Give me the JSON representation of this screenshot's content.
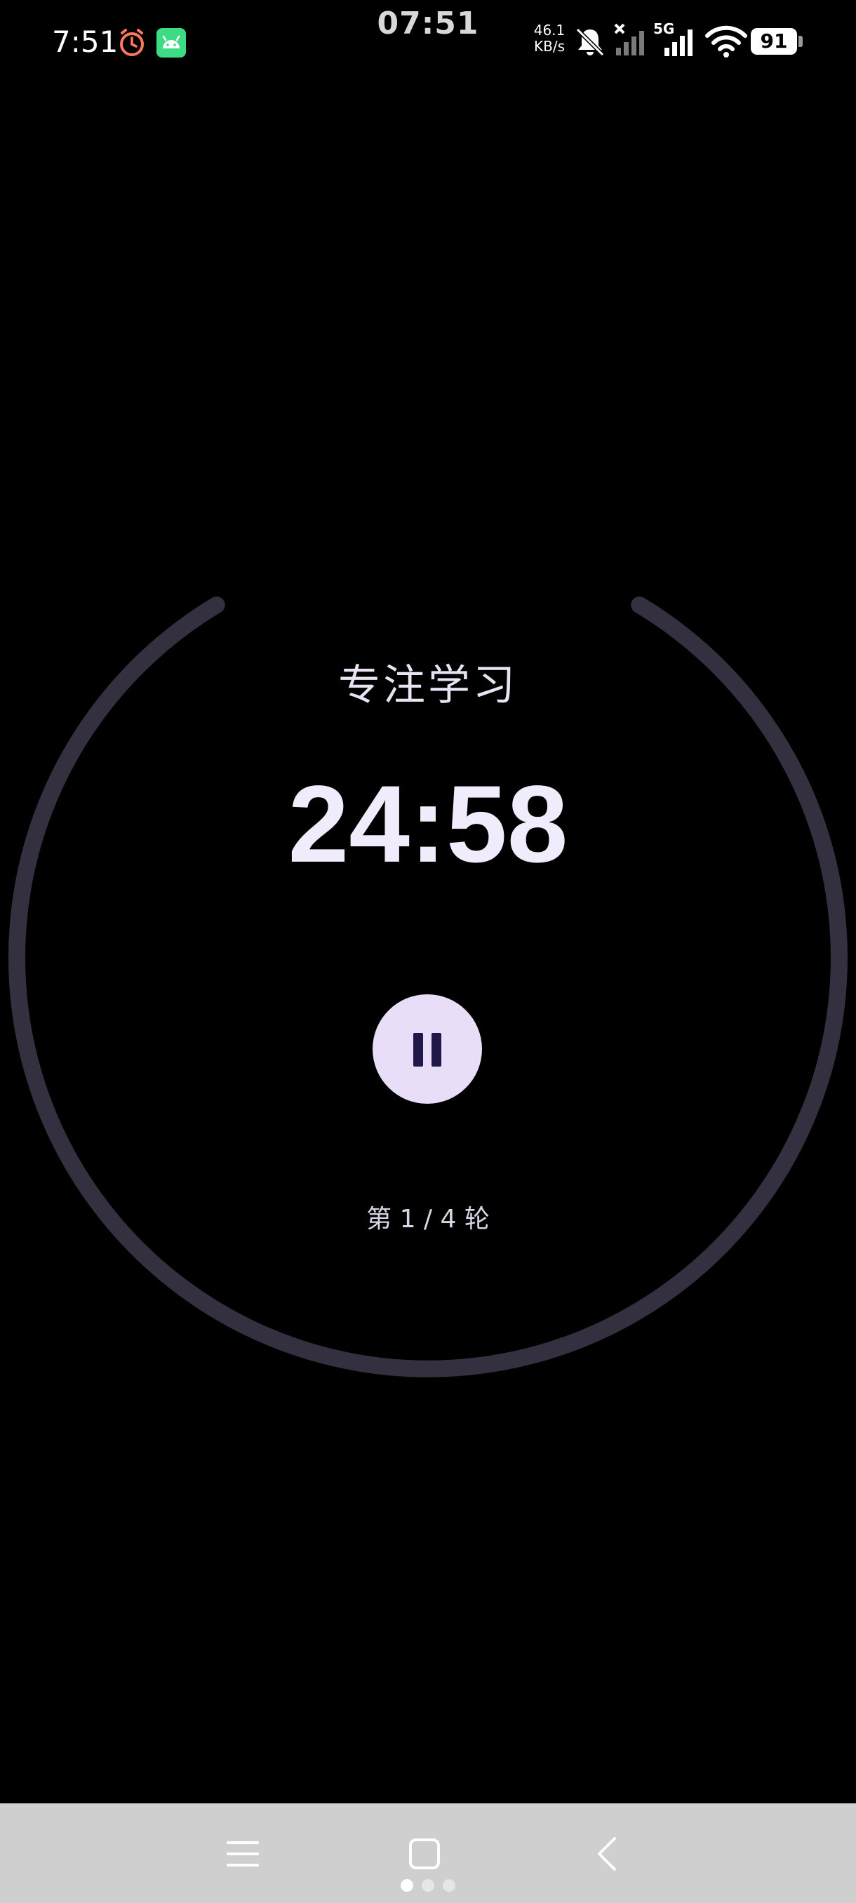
{
  "status_bar": {
    "time": "7:51",
    "center_clock": "07:51",
    "net_speed_value": "46.1",
    "net_speed_unit": "KB/s",
    "network_type": "5G",
    "battery_level": "91",
    "notification_icons": [
      "alarm-clock-icon",
      "android-robot-icon"
    ],
    "system_icons": [
      "bell-muted-icon",
      "signal-no-service-icon",
      "cellular-signal-icon",
      "wifi-icon",
      "battery-icon"
    ]
  },
  "timer": {
    "session_label": "专注学习",
    "remaining": "24:58",
    "round_text": "第 1 / 4 轮",
    "control_state": "running",
    "control_icon": "pause-icon"
  },
  "colors": {
    "background": "#000000",
    "ring_track": "#35303f",
    "button_fill": "#e8def8",
    "button_icon": "#21184a",
    "text_primary": "#f1ecfb",
    "nav_bar": "#cfcfcf"
  },
  "nav_bar": {
    "buttons": [
      "menu-icon",
      "home-square-icon",
      "back-chevron-icon"
    ],
    "page_count": 3,
    "active_page": 1
  }
}
